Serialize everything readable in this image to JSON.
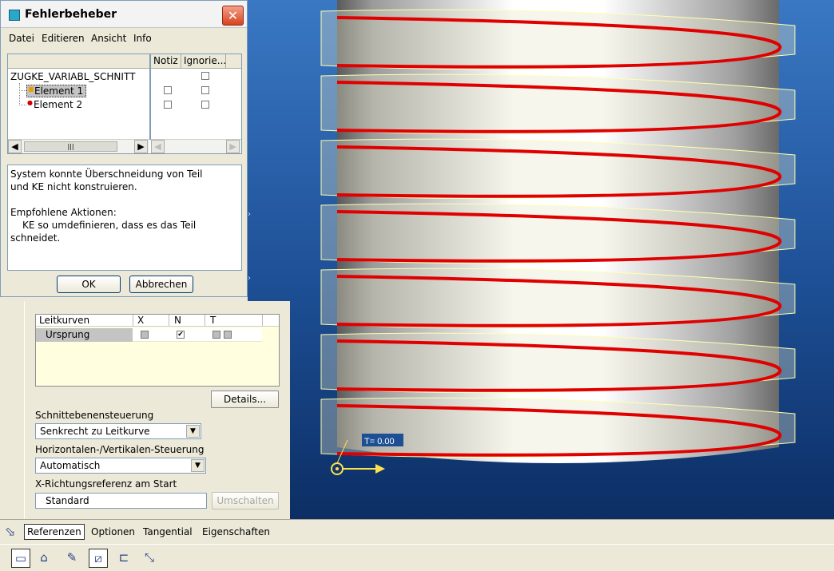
{
  "dialog": {
    "title": "Fehlerbeheber",
    "menu": [
      "Datei",
      "Editieren",
      "Ansicht",
      "Info"
    ],
    "columns": {
      "notiz": "Notiz",
      "ignorieren": "Ignorie..."
    },
    "tree": {
      "root": "ZUGKE_VARIABL_SCHNITT",
      "items": [
        {
          "label": "Element 1",
          "selected": true,
          "notiz": false,
          "ignorieren": false
        },
        {
          "label": "Element 2",
          "selected": false,
          "notiz": false,
          "ignorieren": false
        }
      ]
    },
    "message": {
      "line1": "System konnte Überschneidung von Teil",
      "line2": "und KE nicht konstruieren.",
      "heading": "Empfohlene Aktionen:",
      "action1": "KE so umdefinieren, dass es das Teil",
      "action2": "schneidet."
    },
    "ok": "OK",
    "cancel": "Abbrechen"
  },
  "panel": {
    "table": {
      "headers": [
        "Leitkurven",
        "X",
        "N",
        "T"
      ],
      "rows": [
        {
          "name": "Ursprung",
          "x": false,
          "n": true,
          "t": false
        }
      ]
    },
    "details": "Details...",
    "section_control_label": "Schnittebenensteuerung",
    "section_control_value": "Senkrecht zu Leitkurve",
    "hv_label": "Horizontalen-/Vertikalen-Steuerung",
    "hv_value": "Automatisch",
    "xref_label": "X-Richtungsreferenz am Start",
    "xref_value": "Standard",
    "switch": "Umschalten"
  },
  "tabs": [
    "Referenzen",
    "Optionen",
    "Tangential",
    "Eigenschaften"
  ],
  "viewport": {
    "t_label": "T= 0.00"
  },
  "toolbar": [
    "solid-icon",
    "surface-icon",
    "sketch-edit-icon",
    "trajectory-icon",
    "open-end-icon",
    "cut-icon"
  ]
}
